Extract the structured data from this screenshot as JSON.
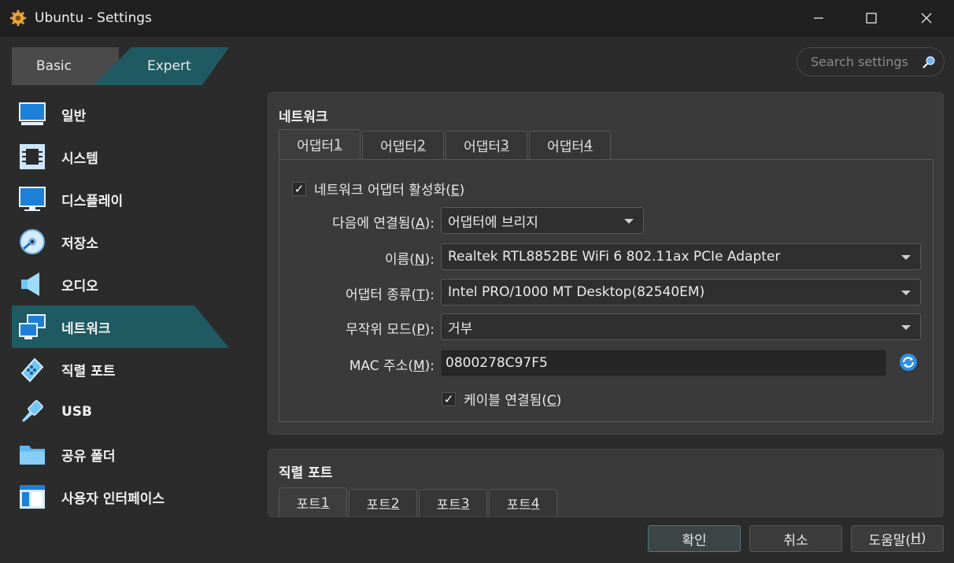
{
  "window": {
    "title": "Ubuntu - Settings"
  },
  "mode": {
    "basic": "Basic",
    "expert": "Expert",
    "selected": "Expert"
  },
  "search": {
    "placeholder": "Search settings"
  },
  "sidebar": {
    "items": [
      {
        "label": "일반",
        "icon": "general-monitor-icon"
      },
      {
        "label": "시스템",
        "icon": "system-chip-icon"
      },
      {
        "label": "디스플레이",
        "icon": "display-monitor-icon"
      },
      {
        "label": "저장소",
        "icon": "storage-disk-icon"
      },
      {
        "label": "오디오",
        "icon": "audio-speaker-icon"
      },
      {
        "label": "네트워크",
        "icon": "network-icon",
        "active": true
      },
      {
        "label": "직렬 포트",
        "icon": "serial-port-icon"
      },
      {
        "label": "USB",
        "icon": "usb-icon"
      },
      {
        "label": "공유 폴더",
        "icon": "shared-folder-icon"
      },
      {
        "label": "사용자 인터페이스",
        "icon": "user-interface-icon"
      }
    ]
  },
  "network": {
    "title": "네트워크",
    "tabs": [
      {
        "label": "어댑터 ",
        "num": "1"
      },
      {
        "label": "어댑터 ",
        "num": "2"
      },
      {
        "label": "어댑터 ",
        "num": "3"
      },
      {
        "label": "어댑터 ",
        "num": "4"
      }
    ],
    "enable": {
      "label": "네트워크 어댑터 활성화(",
      "key": "E",
      "end": ")",
      "checked": true
    },
    "attached": {
      "label": "다음에 연결됨(",
      "key": "A",
      "end": "):",
      "value": "어댑터에 브리지"
    },
    "name": {
      "label": "이름(",
      "key": "N",
      "end": "):",
      "value": "Realtek RTL8852BE WiFi 6 802.11ax PCIe Adapter"
    },
    "adapter_type": {
      "label": "어댑터 종류(",
      "key": "T",
      "end": "):",
      "value": "Intel PRO/1000 MT Desktop(82540EM)"
    },
    "promisc": {
      "label": "무작위 모드(",
      "key": "P",
      "end": "):",
      "value": "거부"
    },
    "mac": {
      "label": "MAC 주소(",
      "key": "M",
      "end": "):",
      "value": "0800278C97F5"
    },
    "cable": {
      "label": "케이블 연결됨(",
      "key": "C",
      "end": ")",
      "checked": true
    }
  },
  "serial": {
    "title": "직렬 포트",
    "tabs": [
      {
        "label": "포트 ",
        "num": "1"
      },
      {
        "label": "포트 ",
        "num": "2"
      },
      {
        "label": "포트 ",
        "num": "3"
      },
      {
        "label": "포트 ",
        "num": "4"
      }
    ]
  },
  "buttons": {
    "ok": "확인",
    "cancel": "취소",
    "help": "도움말(",
    "help_key": "H",
    "help_end": ")"
  },
  "colors": {
    "accent": "#1f5a62",
    "background": "#2b2b2b",
    "panel": "#3a3a3a"
  }
}
